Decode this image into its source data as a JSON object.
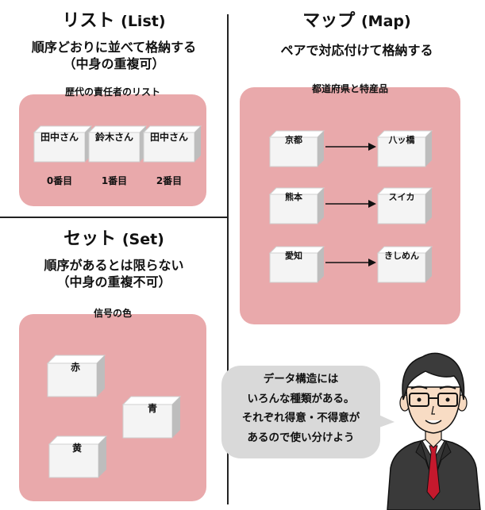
{
  "list": {
    "title_ja": "リスト",
    "title_en": "(List)",
    "desc_line1": "順序どおりに並べて格納する",
    "desc_line2": "（中身の重複可）",
    "panel_label": "歴代の責任者のリスト",
    "items": [
      {
        "name": "田中さん",
        "index": "0番目"
      },
      {
        "name": "鈴木さん",
        "index": "1番目"
      },
      {
        "name": "田中さん",
        "index": "2番目"
      }
    ]
  },
  "set": {
    "title_ja": "セット",
    "title_en": "(Set)",
    "desc_line1": "順序があるとは限らない",
    "desc_line2": "（中身の重複不可）",
    "panel_label": "信号の色",
    "items": [
      "赤",
      "青",
      "黄"
    ]
  },
  "map": {
    "title_ja": "マップ",
    "title_en": "(Map)",
    "desc": "ペアで対応付けて格納する",
    "panel_label": "都道府県と特産品",
    "pairs": [
      {
        "key": "京都",
        "value": "八ッ橋"
      },
      {
        "key": "熊本",
        "value": "スイカ"
      },
      {
        "key": "愛知",
        "value": "きしめん"
      }
    ]
  },
  "speech": {
    "lines": [
      "データ構造には",
      "いろんな種類がある。",
      "それぞれ得意・不得意が",
      "あるので使い分けよう"
    ]
  },
  "colors": {
    "panel": "#e9a9ab",
    "box_top": "#ffffff",
    "box_front": "#f4f4f4",
    "box_side": "#bdbdbd",
    "bubble": "#d9d9d9",
    "suit": "#3a3a3a",
    "tie": "#c5192d"
  }
}
